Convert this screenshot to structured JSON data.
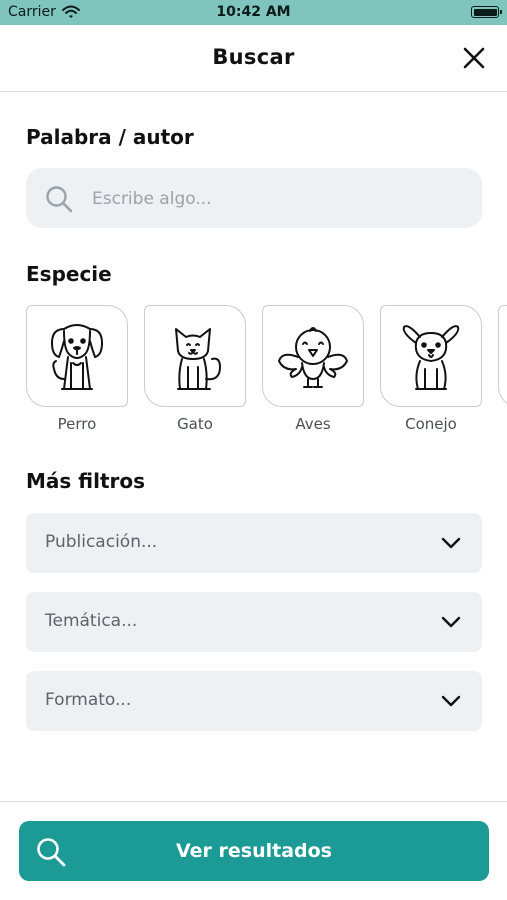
{
  "status_bar": {
    "carrier": "Carrier",
    "time": "10:42 AM"
  },
  "header": {
    "title": "Buscar"
  },
  "keyword_section": {
    "title": "Palabra / autor",
    "placeholder": "Escribe algo..."
  },
  "species_section": {
    "title": "Especie",
    "items": [
      {
        "label": "Perro",
        "icon": "dog-icon"
      },
      {
        "label": "Gato",
        "icon": "cat-icon"
      },
      {
        "label": "Aves",
        "icon": "bird-icon"
      },
      {
        "label": "Conejo",
        "icon": "rabbit-icon"
      }
    ]
  },
  "filters_section": {
    "title": "Más filtros",
    "dropdowns": [
      {
        "label": "Publicación..."
      },
      {
        "label": "Temática..."
      },
      {
        "label": "Formato..."
      }
    ]
  },
  "footer": {
    "results_label": "Ver resultados"
  },
  "colors": {
    "status_bar": "#80c5bd",
    "accent": "#1b9a96",
    "field_bg": "#eef1f3"
  }
}
